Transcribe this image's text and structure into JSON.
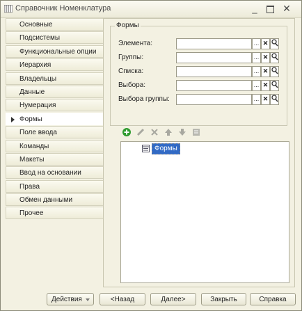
{
  "window": {
    "title": "Справочник Номенклатура"
  },
  "sidebar": {
    "items": [
      {
        "label": "Основные"
      },
      {
        "label": "Подсистемы"
      },
      {
        "label": "Функциональные опции"
      },
      {
        "label": "Иерархия"
      },
      {
        "label": "Владельцы"
      },
      {
        "label": "Данные"
      },
      {
        "label": "Нумерация"
      },
      {
        "label": "Формы",
        "active": true
      },
      {
        "label": "Поле ввода"
      },
      {
        "label": "Команды"
      },
      {
        "label": "Макеты"
      },
      {
        "label": "Ввод на основании"
      },
      {
        "label": "Права"
      },
      {
        "label": "Обмен данными"
      },
      {
        "label": "Прочее"
      }
    ]
  },
  "forms_group": {
    "title": "Формы",
    "fields": [
      {
        "label": "Элемента:",
        "value": ""
      },
      {
        "label": "Группы:",
        "value": ""
      },
      {
        "label": "Списка:",
        "value": ""
      },
      {
        "label": "Выбора:",
        "value": ""
      },
      {
        "label": "Выбора группы:",
        "value": ""
      }
    ],
    "select_button": "...",
    "clear_button": "✕"
  },
  "tree": {
    "root_label": "Формы"
  },
  "buttons": {
    "actions": "Действия",
    "back": "<Назад",
    "next": "Далее>",
    "close": "Закрыть",
    "help": "Справка"
  },
  "colors": {
    "selection": "#316ac5",
    "add": "#2e9b2e"
  }
}
